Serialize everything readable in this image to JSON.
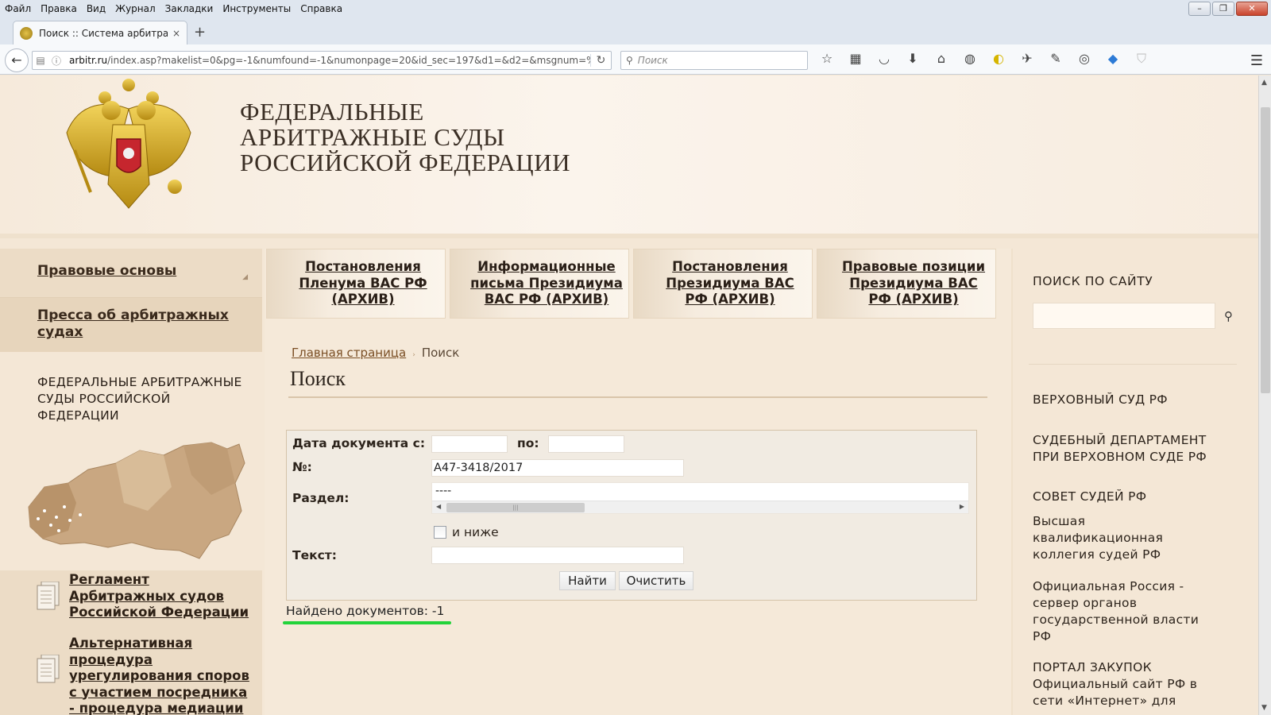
{
  "browser": {
    "menu": [
      "Файл",
      "Правка",
      "Вид",
      "Журнал",
      "Закладки",
      "Инструменты",
      "Справка"
    ],
    "tab_title": "Поиск :: Система арбитра...",
    "tab_close": "×",
    "new_tab": "+",
    "url_host": "arbitr.ru",
    "url_path": "/index.asp?makelist=0&pg=-1&numfound=-1&numonpage=20&id_sec=197&d1=&d2=&msgnum=%",
    "search_placeholder": "Поиск",
    "toolbar_icons": [
      "star-icon",
      "reading-list-icon",
      "pocket-icon",
      "download-icon",
      "home-icon",
      "addon-icon",
      "yellow-shield-icon",
      "plane-icon",
      "edit-icon",
      "globe-icon",
      "diamond-icon",
      "shield-icon",
      "menu-icon"
    ]
  },
  "header": {
    "title_line1": "ФЕДЕРАЛЬНЫЕ",
    "title_line2": "АРБИТРАЖНЫЕ СУДЫ",
    "title_line3": "РОССИЙСКОЙ ФЕДЕРАЦИИ"
  },
  "left": {
    "nav1": "Правовые основы",
    "nav2": "Пресса об арбитражных судах",
    "block_title": "ФЕДЕРАЛЬНЫЕ АРБИТРАЖНЫЕ СУДЫ РОССИЙСКОЙ ФЕДЕРАЦИИ",
    "doc1": "Регламент Арбитражных судов Российской Федерации",
    "doc2": "Альтернативная процедура урегулирования споров с участием посредника - процедура медиации"
  },
  "topnav": [
    {
      "label": "Постановления Пленума ВАС РФ (АРХИВ)"
    },
    {
      "label": "Информационные письма Президиума ВАС РФ (АРХИВ)"
    },
    {
      "label": "Постановления Президиума ВАС РФ (АРХИВ)"
    },
    {
      "label": "Правовые позиции Президиума ВАС РФ (АРХИВ)"
    }
  ],
  "breadcrumb": {
    "home": "Главная страница",
    "sep": "›",
    "current": "Поиск"
  },
  "page_title": "Поиск",
  "form": {
    "date_from_label": "Дата документа с:",
    "date_to_label": "по:",
    "date_from": "",
    "date_to": "",
    "number_label": "№:",
    "number_value": "А47-3418/2017",
    "section_label": "Раздел:",
    "section_value": "----",
    "below_label": "и ниже",
    "below_checked": false,
    "text_label": "Текст:",
    "text_value": "",
    "find_button": "Найти",
    "clear_button": "Очистить"
  },
  "result": {
    "found_text": "Найдено документов: -1"
  },
  "right": {
    "search_title": "ПОИСК ПО САЙТУ",
    "links": [
      "ВЕРХОВНЫЙ СУД РФ",
      "СУДЕБНЫЙ ДЕПАРТАМЕНТ ПРИ ВЕРХОВНОМ СУДЕ РФ",
      "СОВЕТ СУДЕЙ РФ",
      "Высшая квалификационная коллегия судей РФ",
      "Официальная Россия - сервер органов государственной власти РФ",
      "ПОРТАЛ ЗАКУПОК Официальный сайт РФ в сети «Интернет» для"
    ]
  },
  "colors": {
    "accent_underline": "#22d33a",
    "page_bg": "#f4e7d6"
  }
}
